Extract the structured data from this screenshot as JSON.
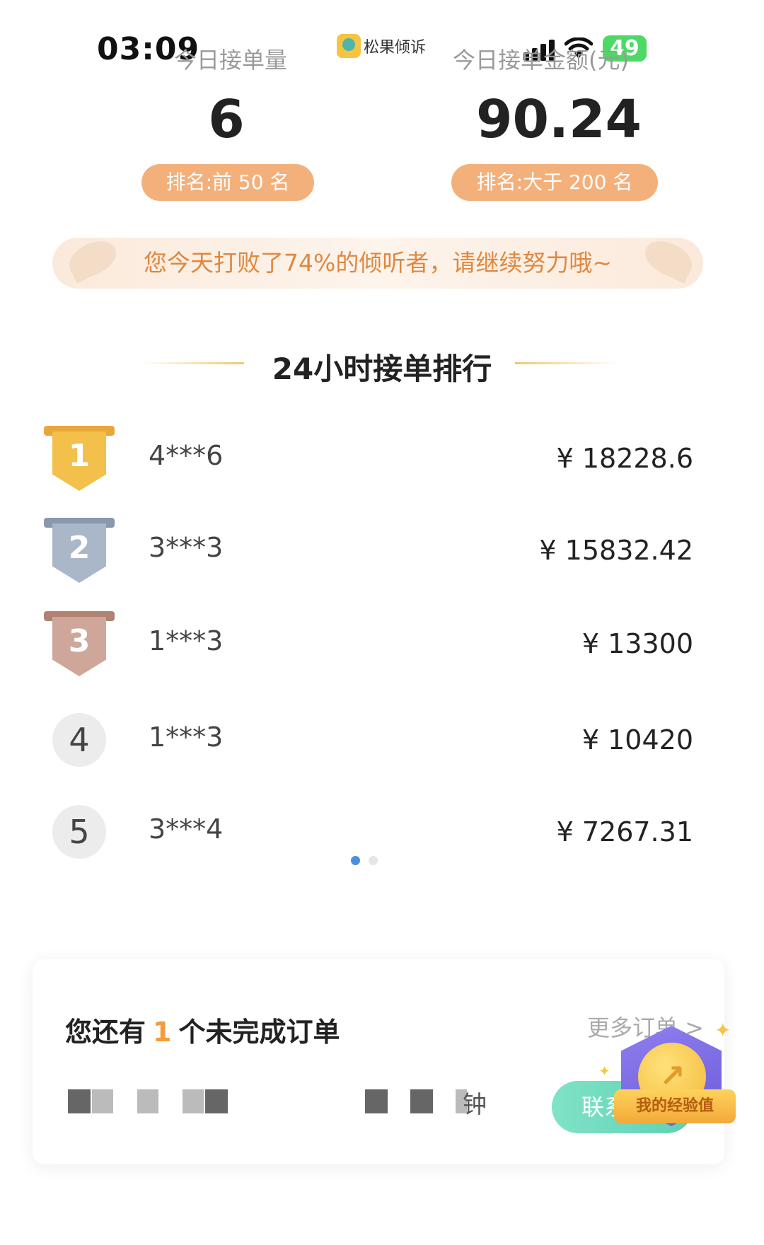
{
  "status_bar": {
    "time": "03:09",
    "battery": "49",
    "battery_icon": "battery-charging-icon",
    "wifi_icon": "wifi-icon"
  },
  "app": {
    "name": "松果倾诉"
  },
  "stats": {
    "orders_label": "今日接单量",
    "orders_value": "6",
    "orders_rank": "排名:前 50 名",
    "amount_label": "今日接单金额(元)",
    "amount_value": "90.24",
    "amount_rank": "排名:大于 200 名"
  },
  "banner": {
    "text": "您今天打败了74%的倾听者，请继续努力哦~"
  },
  "ranking": {
    "title": "24小时接单排行",
    "rows": [
      {
        "rank": "1",
        "name": "4***6",
        "amount": "¥ 18228.6",
        "medal_color": "#f3c04b"
      },
      {
        "rank": "2",
        "name": "3***3",
        "amount": "¥ 15832.42",
        "medal_color": "#a9b7c9"
      },
      {
        "rank": "3",
        "name": "1***3",
        "amount": "¥ 13300",
        "medal_color": "#cfa79a"
      },
      {
        "rank": "4",
        "name": "1***3",
        "amount": "¥ 10420"
      },
      {
        "rank": "5",
        "name": "3***4",
        "amount": "¥ 7267.31"
      }
    ],
    "page_count": 2,
    "active_page": 1
  },
  "order_card": {
    "prefix": "您还有",
    "count": "1",
    "suffix": "个未完成订单",
    "more_label": "更多订单 >",
    "minute_text": "钟",
    "contact_label": "联系"
  },
  "exp_badge": {
    "label": "我的经验值"
  }
}
